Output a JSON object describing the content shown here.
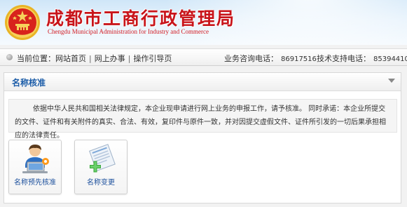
{
  "header": {
    "title": "成都市工商行政管理局",
    "subtitle": "Chengdu Municipal Administration for Industry and Commerce",
    "emblem_icon": "national-emblem-icon"
  },
  "navbar": {
    "location_label": "当前位置：",
    "breadcrumb": [
      "网站首页",
      "网上办事",
      "操作引导页"
    ],
    "separator": "|",
    "business_phone_label": "业务咨询电话：",
    "business_phone": "86917516",
    "tech_phone_label": "技术支持电话：",
    "tech_phone": "85394410"
  },
  "panel": {
    "title": "名称核准",
    "notice": "依据中华人民共和国相关法律规定，本企业现申请进行网上业务的申报工作，请予核准。 同时承诺：本企业所提交的文件、证件和有关附件的真实、合法、有效，复印件与原件一致，并对因提交虚假文件、证件所引发的一切后果承担相应的法律责任。",
    "tiles": [
      {
        "label": "名称预先核准",
        "icon": "person-at-computer-icon"
      },
      {
        "label": "名称变更",
        "icon": "document-add-icon"
      }
    ]
  },
  "colors": {
    "title_red": "#c8141a",
    "link_blue": "#1b5ca8",
    "plus_green": "#3aa83a"
  }
}
